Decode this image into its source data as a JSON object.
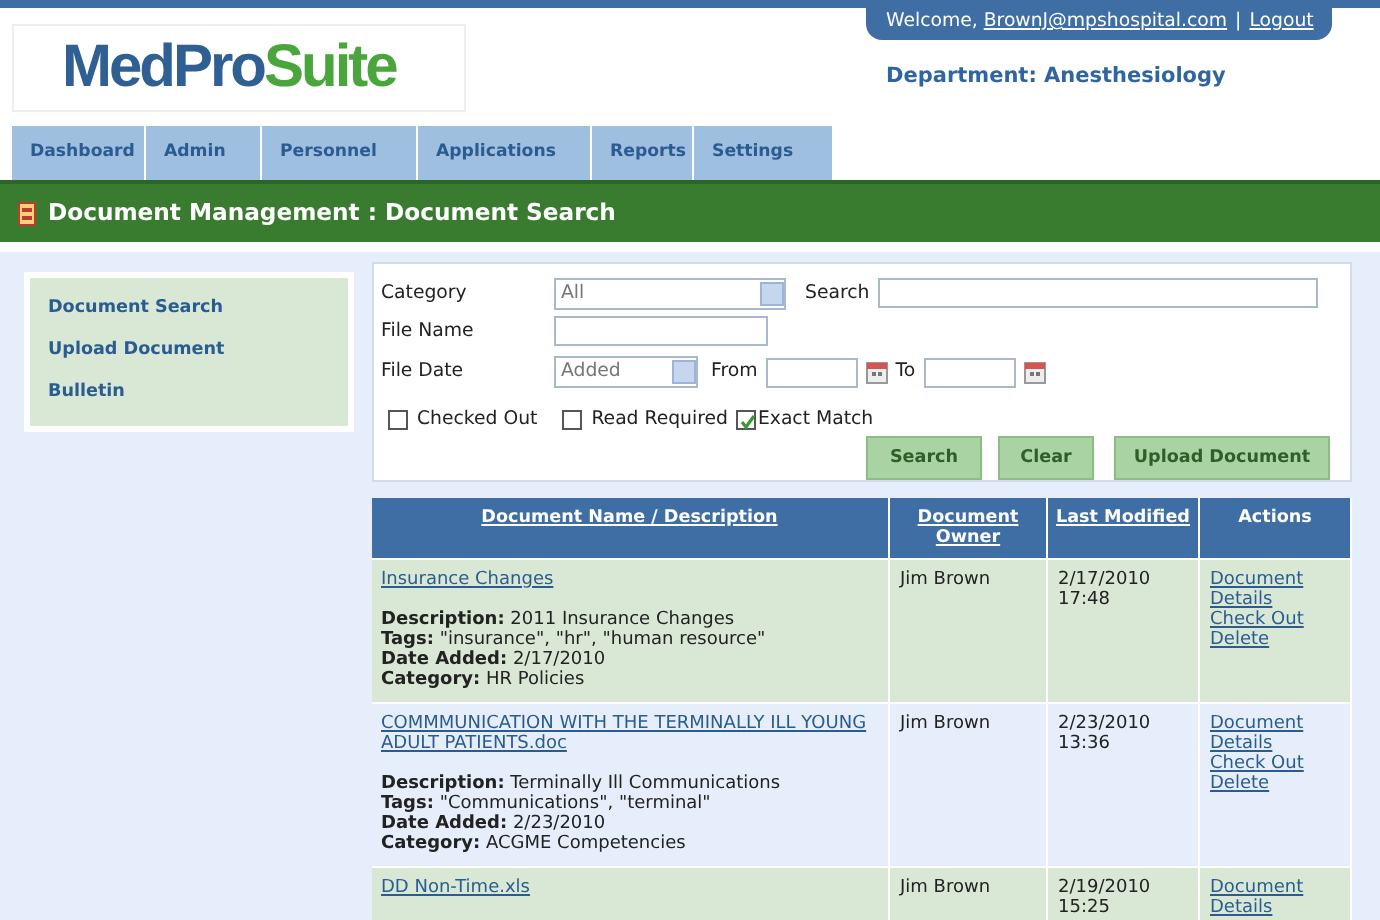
{
  "logo": {
    "part_1": "MedPro",
    "part_2": "Suite"
  },
  "user_bar": {
    "welcome": "Welcome,",
    "email": "BrownJ@mpshospital.com",
    "separator": "|",
    "logout": "Logout"
  },
  "department": "Department: Anesthesiology",
  "nav_tabs": [
    {
      "label": "Dashboard"
    },
    {
      "label": "Admin"
    },
    {
      "label": "Personnel"
    },
    {
      "label": "Applications"
    },
    {
      "label": "Reports"
    },
    {
      "label": "Settings"
    }
  ],
  "page_title": "Document Management : Document Search",
  "sidebar": {
    "items": [
      {
        "label": "Document Search"
      },
      {
        "label": "Upload Document"
      },
      {
        "label": "Bulletin"
      }
    ]
  },
  "search_form": {
    "category_label": "Category",
    "category_value": "All",
    "search_label": "Search",
    "file_name_label": "File Name",
    "file_date_label": "File Date",
    "file_date_value": "Added",
    "from_label": "From",
    "to_label": "To",
    "checkboxes": [
      {
        "label": "Checked Out",
        "checked": false
      },
      {
        "label": "Read Required",
        "checked": false
      },
      {
        "label": "Exact Match",
        "checked": true
      }
    ],
    "buttons": [
      "Search",
      "Clear",
      "Upload Document"
    ]
  },
  "table": {
    "columns": [
      "Document Name / Description",
      "Document Owner",
      "Last Modified",
      "Actions"
    ],
    "rows": [
      {
        "name": "Insurance Changes",
        "details": [
          "**Description:** 2011 Insurance Changes",
          "**Tags:** \"insurance\", \"hr\", \"human resource\"",
          "**Date Added:** 2/17/2010",
          "**Category:** HR Policies"
        ],
        "owner": "Jim Brown",
        "modified": "2/17/2010 17:48",
        "actions": [
          "Document Details",
          "Check Out",
          "Delete"
        ]
      },
      {
        "name": "COMMMUNICATION WITH THE TERMINALLY ILL YOUNG ADULT PATIENTS.doc",
        "details": [
          "**Description:** Terminally Ill Communications",
          "**Tags:** \"Communications\", \"terminal\"",
          "**Date Added:** 2/23/2010",
          "**Category:** ACGME Competencies"
        ],
        "owner": "Jim Brown",
        "modified": "2/23/2010 13:36",
        "actions": [
          "Document Details",
          "Check Out",
          "Delete"
        ]
      },
      {
        "name": "DD Non-Time.xls",
        "details": [],
        "owner": "Jim Brown",
        "modified": "2/19/2010 15:25",
        "actions": [
          "Document Details"
        ]
      }
    ]
  }
}
